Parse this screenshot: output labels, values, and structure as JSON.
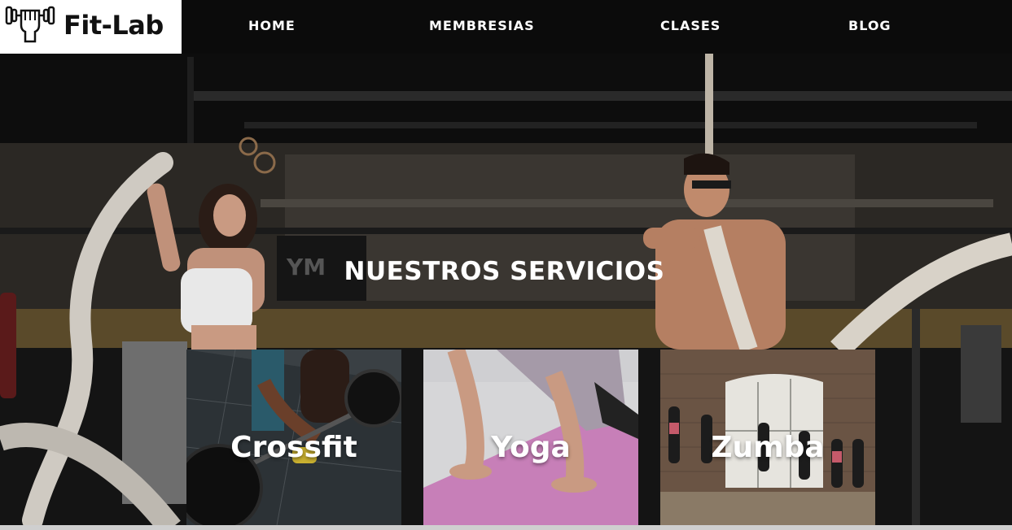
{
  "brand": {
    "name": "Fit-Lab",
    "icon": "dumbbell-fist-icon"
  },
  "nav": {
    "items": [
      {
        "label": "HOME"
      },
      {
        "label": "MEMBRESIAS"
      },
      {
        "label": "CLASES"
      },
      {
        "label": "BLOG"
      }
    ]
  },
  "hero": {
    "title": "NUESTROS SERVICIOS"
  },
  "services": [
    {
      "label": "Crossfit"
    },
    {
      "label": "Yoga"
    },
    {
      "label": "Zumba"
    }
  ],
  "colors": {
    "header_bg": "#0b0b0b",
    "logo_bg": "#ffffff",
    "text": "#ffffff"
  }
}
